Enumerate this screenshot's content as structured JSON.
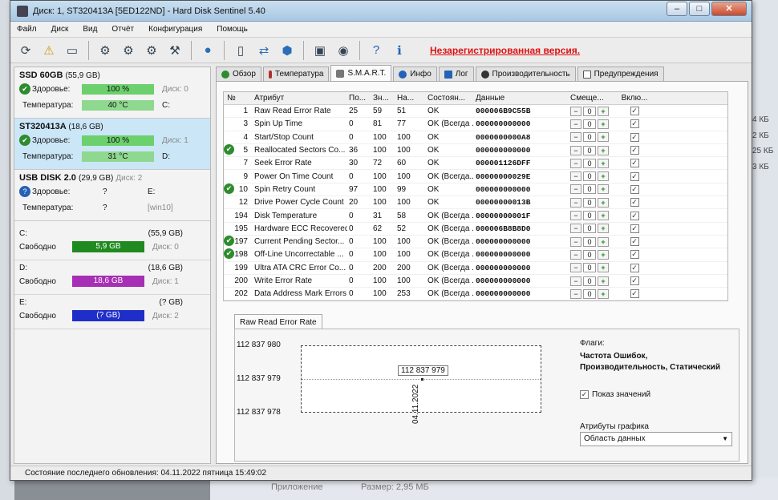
{
  "window": {
    "title": "Диск: 1, ST320413A [5ED122ND]  -  Hard Disk Sentinel 5.40"
  },
  "menu": [
    "Файл",
    "Диск",
    "Вид",
    "Отчёт",
    "Конфигурация",
    "Помощь"
  ],
  "toolbar": {
    "icons": [
      "refresh-icon",
      "warning-icon",
      "disk-icon",
      "test-icon",
      "test2-icon",
      "test3-icon",
      "tools-icon",
      "web-icon",
      "report-icon",
      "sync-icon",
      "network-icon",
      "terminal-icon",
      "camera-icon",
      "help-icon",
      "info-icon"
    ],
    "unregistered": "Незарегистрированная версия."
  },
  "left": {
    "disks": [
      {
        "name": "SSD 60GB",
        "size": "(55,9 GB)",
        "health_label": "Здоровье:",
        "health": "100 %",
        "health_pct": 100,
        "temp_label": "Температура:",
        "temp": "40 °C",
        "disk_ref": "Диск: 0",
        "vol": "C:"
      },
      {
        "name": "ST320413A",
        "size": "(18,6 GB)",
        "health_label": "Здоровье:",
        "health": "100 %",
        "health_pct": 100,
        "temp_label": "Температура:",
        "temp": "31 °C",
        "disk_ref": "Диск: 1",
        "vol": "D:"
      },
      {
        "name": "USB DISK 2.0",
        "size": "(29,9 GB)",
        "disk_ref_inline": "Диск: 2",
        "health_label": "Здоровье:",
        "health": "?",
        "temp_label": "Температура:",
        "temp": "?",
        "extra1": "E:",
        "extra2": "[win10]"
      }
    ],
    "volumes": [
      {
        "letter": "C:",
        "total": "(55,9 GB)",
        "free_label": "Свободно",
        "free": "5,9 GB",
        "disk": "Диск: 0",
        "color": "#1f8a1f"
      },
      {
        "letter": "D:",
        "total": "(18,6 GB)",
        "free_label": "Свободно",
        "free": "18,6 GB",
        "disk": "Диск: 1",
        "color": "#a62fb5"
      },
      {
        "letter": "E:",
        "total": "(? GB)",
        "free_label": "Свободно",
        "free": "(? GB)",
        "disk": "Диск: 2",
        "color": "#1f2ec9"
      }
    ]
  },
  "tabs": [
    "Обзор",
    "Температура",
    "S.M.A.R.T.",
    "Инфо",
    "Лог",
    "Производительность",
    "Предупреждения"
  ],
  "smart": {
    "headers": [
      "№",
      "Атрибут",
      "По...",
      "Зн...",
      "На...",
      "Состоян...",
      "Данные",
      "Смеще...",
      "Вклю..."
    ],
    "rows": [
      {
        "no": "1",
        "attr": "Raw Read Error Rate",
        "thr": "25",
        "val": "59",
        "worst": "51",
        "status": "OK",
        "data": "000006B9C55B",
        "ok": false
      },
      {
        "no": "3",
        "attr": "Spin Up Time",
        "thr": "0",
        "val": "81",
        "worst": "77",
        "status": "OK (Всегда ...",
        "data": "000000000000",
        "ok": false
      },
      {
        "no": "4",
        "attr": "Start/Stop Count",
        "thr": "0",
        "val": "100",
        "worst": "100",
        "status": "OK",
        "data": "0000000000A8",
        "ok": false
      },
      {
        "no": "5",
        "attr": "Reallocated Sectors Co...",
        "thr": "36",
        "val": "100",
        "worst": "100",
        "status": "OK",
        "data": "000000000000",
        "ok": true
      },
      {
        "no": "7",
        "attr": "Seek Error Rate",
        "thr": "30",
        "val": "72",
        "worst": "60",
        "status": "OK",
        "data": "000001126DFF",
        "ok": false
      },
      {
        "no": "9",
        "attr": "Power On Time Count",
        "thr": "0",
        "val": "100",
        "worst": "100",
        "status": "OK (Всегда...",
        "data": "00000000029E",
        "ok": false
      },
      {
        "no": "10",
        "attr": "Spin Retry Count",
        "thr": "97",
        "val": "100",
        "worst": "99",
        "status": "OK",
        "data": "000000000000",
        "ok": true
      },
      {
        "no": "12",
        "attr": "Drive Power Cycle Count",
        "thr": "20",
        "val": "100",
        "worst": "100",
        "status": "OK",
        "data": "00000000013B",
        "ok": false
      },
      {
        "no": "194",
        "attr": "Disk Temperature",
        "thr": "0",
        "val": "31",
        "worst": "58",
        "status": "OK (Всегда ...",
        "data": "00000000001F",
        "ok": false
      },
      {
        "no": "195",
        "attr": "Hardware ECC Recovered",
        "thr": "0",
        "val": "62",
        "worst": "52",
        "status": "OK (Всегда ...",
        "data": "000006B8B8D0",
        "ok": false
      },
      {
        "no": "197",
        "attr": "Current Pending Sector...",
        "thr": "0",
        "val": "100",
        "worst": "100",
        "status": "OK (Всегда ...",
        "data": "000000000000",
        "ok": true
      },
      {
        "no": "198",
        "attr": "Off-Line Uncorrectable ...",
        "thr": "0",
        "val": "100",
        "worst": "100",
        "status": "OK (Всегда ...",
        "data": "000000000000",
        "ok": true
      },
      {
        "no": "199",
        "attr": "Ultra ATA CRC Error Co...",
        "thr": "0",
        "val": "200",
        "worst": "200",
        "status": "OK (Всегда ...",
        "data": "000000000000",
        "ok": false
      },
      {
        "no": "200",
        "attr": "Write Error Rate",
        "thr": "0",
        "val": "100",
        "worst": "100",
        "status": "OK (Всегда ...",
        "data": "000000000000",
        "ok": false
      },
      {
        "no": "202",
        "attr": "Data Address Mark Errors",
        "thr": "0",
        "val": "100",
        "worst": "253",
        "status": "OK (Всегда ...",
        "data": "000000000000",
        "ok": false
      }
    ],
    "offset": "0"
  },
  "graph": {
    "tab": "Raw Read Error Rate",
    "flags_label": "Флаги:",
    "flags_value": "Частота Ошибок, Производительность, Статический",
    "show_values": "Показ значений",
    "graph_attr_label": "Атрибуты графика",
    "graph_attr_value": "Область данных"
  },
  "chart_data": {
    "type": "line",
    "x": [
      "04.11.2022"
    ],
    "series": [
      {
        "values": [
          112837979
        ]
      }
    ],
    "yticks": [
      "112 837 980",
      "112 837 979",
      "112 837 978"
    ],
    "ylim": [
      112837978,
      112837980
    ],
    "point_label": "112 837 979"
  },
  "status": "Состояние последнего обновления: 04.11.2022 пятница 15:49:02",
  "background": {
    "right_items": [
      "4 КБ",
      "2 КБ",
      "25 КБ",
      "3 КБ"
    ],
    "bottom_items": [
      "Приложение",
      "Размер: 2,95 МБ"
    ]
  }
}
